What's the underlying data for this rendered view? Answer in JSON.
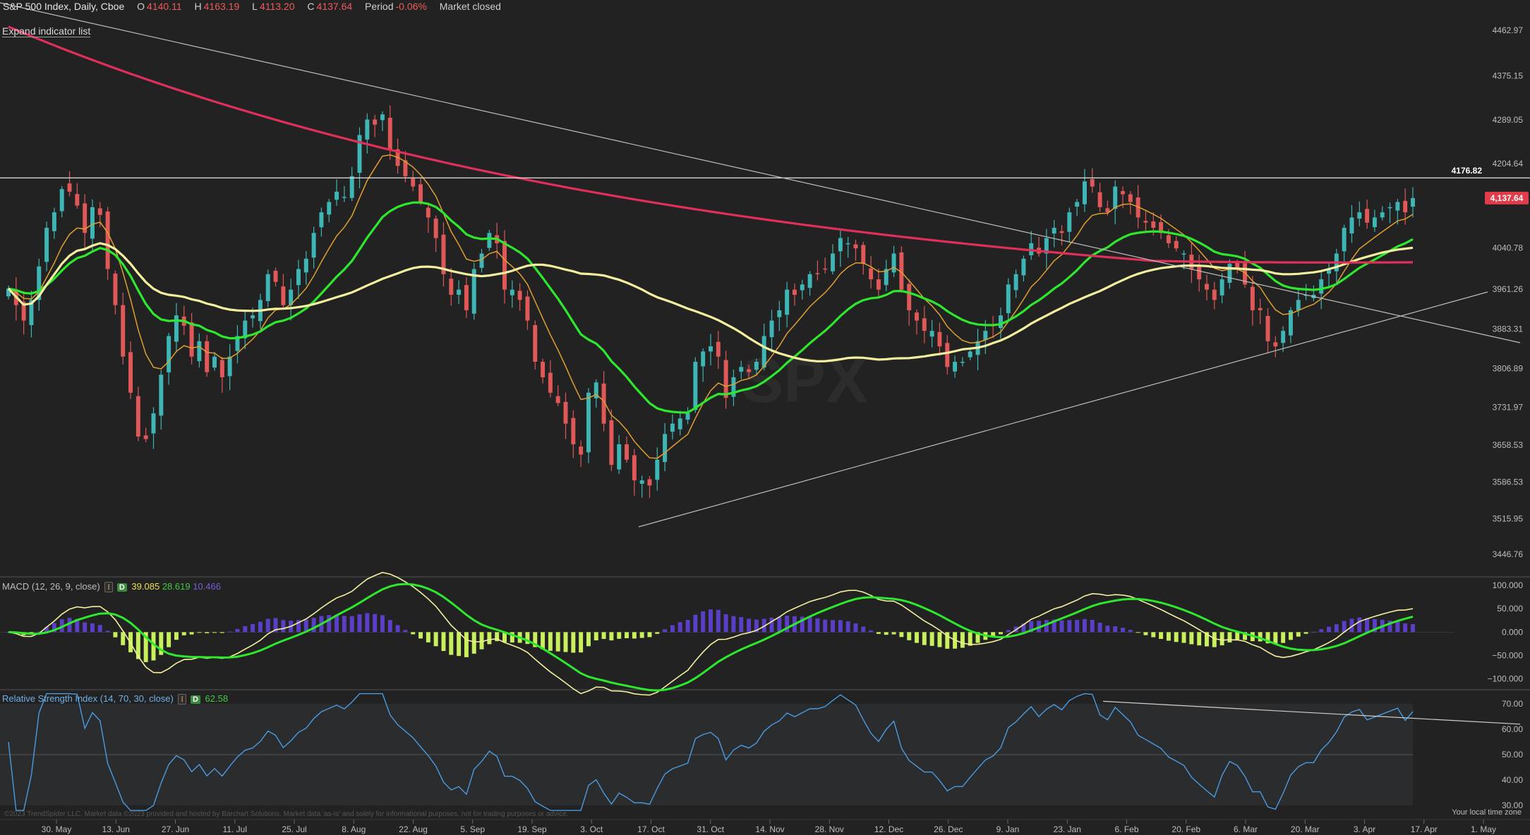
{
  "header": {
    "title": "S&P 500 Index, Daily, Cboe",
    "open_label": "O",
    "open": "4140.11",
    "high_label": "H",
    "high": "4163.19",
    "low_label": "L",
    "low": "4113.20",
    "close_label": "C",
    "close": "4137.64",
    "period_label": "Period",
    "period": "-0.06%",
    "market_status": "Market closed"
  },
  "expand_label": "Expand indicator list",
  "watermark": "SPX",
  "chart_data": {
    "type": "candlestick",
    "price_axis": {
      "ticks": [
        4462.97,
        4375.15,
        4289.05,
        4204.64,
        4040.78,
        3961.26,
        3883.31,
        3806.89,
        3731.97,
        3658.53,
        3586.53,
        3515.95,
        3446.76
      ],
      "range": [
        3400,
        4500
      ]
    },
    "x_labels": [
      "30. May",
      "13. Jun",
      "27. Jun",
      "11. Jul",
      "25. Jul",
      "8. Aug",
      "22. Aug",
      "5. Sep",
      "19. Sep",
      "3. Oct",
      "17. Oct",
      "31. Oct",
      "14. Nov",
      "28. Nov",
      "12. Dec",
      "26. Dec",
      "9. Jan",
      "23. Jan",
      "6. Feb",
      "20. Feb",
      "6. Mar",
      "20. Mar",
      "3. Apr",
      "17. Apr",
      "1. May"
    ],
    "resistance_level": "4176.82",
    "last_price": "4,137.64",
    "closes": [
      3962,
      3930,
      3900,
      3940,
      4005,
      4080,
      4110,
      4155,
      4150,
      4123,
      4070,
      4120,
      4105,
      4000,
      3930,
      3830,
      3760,
      3675,
      3670,
      3720,
      3795,
      3870,
      3910,
      3890,
      3830,
      3860,
      3800,
      3830,
      3790,
      3830,
      3870,
      3900,
      3910,
      3940,
      3990,
      3975,
      3930,
      3960,
      4000,
      4020,
      4070,
      4110,
      4130,
      4150,
      4140,
      4180,
      4260,
      4290,
      4280,
      4300,
      4230,
      4200,
      4180,
      4160,
      4130,
      4100,
      4060,
      3990,
      3950,
      3960,
      3920,
      4000,
      4030,
      4070,
      4050,
      3960,
      3960,
      3940,
      3900,
      3820,
      3790,
      3760,
      3740,
      3700,
      3660,
      3640,
      3760,
      3780,
      3700,
      3620,
      3660,
      3630,
      3590,
      3590,
      3580,
      3630,
      3680,
      3700,
      3710,
      3720,
      3820,
      3840,
      3850,
      3830,
      3750,
      3790,
      3810,
      3800,
      3820,
      3870,
      3900,
      3920,
      3960,
      3950,
      3970,
      3990,
      3990,
      4000,
      4030,
      4060,
      4050,
      4040,
      4010,
      3980,
      3960,
      4000,
      4030,
      3960,
      3920,
      3900,
      3880,
      3880,
      3850,
      3810,
      3820,
      3820,
      3840,
      3860,
      3880,
      3890,
      3910,
      3970,
      3990,
      4020,
      4050,
      4030,
      4060,
      4080,
      4070,
      4110,
      4130,
      4170,
      4160,
      4120,
      4110,
      4160,
      4145,
      4130,
      4100,
      4090,
      4080,
      4070,
      4050,
      4040,
      4030,
      4000,
      3980,
      3960,
      3940,
      3980,
      4010,
      4000,
      3970,
      3920,
      3920,
      3860,
      3850,
      3880,
      3920,
      3940,
      3950,
      3950,
      3980,
      4000,
      4030,
      4080,
      4100,
      4110,
      4090,
      4100,
      4110,
      4120,
      4130,
      4110,
      4137.64
    ],
    "series": [
      {
        "name": "EMA 8",
        "color": "#e0a030"
      },
      {
        "name": "EMA 21",
        "color": "#2ee82e"
      },
      {
        "name": "SMA 50",
        "color": "#f5f0a0"
      },
      {
        "name": "SMA 200",
        "color": "#e0305a"
      }
    ],
    "macd": {
      "label": "MACD (12, 26, 9, close)",
      "values": [
        "39.085",
        "28.619",
        "10.466"
      ],
      "axis_ticks": [
        "100.000",
        "50.000",
        "0.000",
        "−50.000",
        "−100.000"
      ],
      "range": [
        -120,
        115
      ]
    },
    "rsi": {
      "label": "Relative Strength Index (14, 70, 30, close)",
      "value": "62.58",
      "axis_ticks": [
        70,
        60,
        50,
        40,
        30
      ],
      "range": [
        25,
        75
      ]
    }
  },
  "footer": {
    "timezone": "Your local time zone",
    "disclaimer": "©2023 TrendSpider LLC. Market data ©2023 provided and hosted by Barchart Solutions. Market data 'as-is' and solely for informational purposes, not for trading purposes or advice."
  },
  "colors": {
    "background": "#222222",
    "up": "#3fb6b6",
    "down": "#e05858",
    "histogram_positive": "#5c3fc8",
    "histogram_negative": "#c8ef5c",
    "rsi_line": "#4a9be0"
  }
}
